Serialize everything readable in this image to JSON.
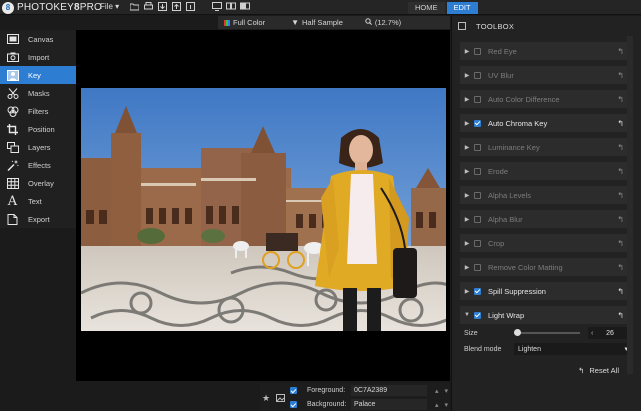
{
  "app": {
    "logo_letter": "8",
    "brand": "PHOTOKEY",
    "brand_num": "8",
    "brand_suffix": "PRO"
  },
  "menu": {
    "file": "File ▾"
  },
  "nav": {
    "home": "HOME",
    "edit": "EDIT"
  },
  "subbar": {
    "color_mode": "Full Color",
    "sample_mode": "Half Sample",
    "zoom": "(12.7%)"
  },
  "sidebar": {
    "items": [
      {
        "label": "Canvas",
        "icon": "canvas-icon"
      },
      {
        "label": "Import",
        "icon": "camera-icon"
      },
      {
        "label": "Key",
        "icon": "key-person-icon"
      },
      {
        "label": "Masks",
        "icon": "scissors-icon"
      },
      {
        "label": "Filters",
        "icon": "filters-icon"
      },
      {
        "label": "Position",
        "icon": "crop-icon"
      },
      {
        "label": "Layers",
        "icon": "layers-icon"
      },
      {
        "label": "Effects",
        "icon": "wand-icon"
      },
      {
        "label": "Overlay",
        "icon": "grid-icon"
      },
      {
        "label": "Text",
        "icon": "text-icon"
      },
      {
        "label": "Export",
        "icon": "export-icon"
      }
    ],
    "active": "Key"
  },
  "bottom": {
    "foreground_label": "Foreground:",
    "foreground_value": "0C7A2389",
    "background_label": "Background:",
    "background_value": "Palace"
  },
  "toolbox": {
    "title": "TOOLBOX",
    "tools": [
      {
        "label": "Red Eye",
        "checked": false
      },
      {
        "label": "UV Blur",
        "checked": false
      },
      {
        "label": "Auto Color Difference",
        "checked": false
      },
      {
        "label": "Auto Chroma Key",
        "checked": true
      },
      {
        "label": "Luminance Key",
        "checked": false
      },
      {
        "label": "Erode",
        "checked": false
      },
      {
        "label": "Alpha Levels",
        "checked": false
      },
      {
        "label": "Alpha Blur",
        "checked": false
      },
      {
        "label": "Crop",
        "checked": false
      },
      {
        "label": "Remove Color Matting",
        "checked": false
      },
      {
        "label": "Spill Suppression",
        "checked": true
      },
      {
        "label": "Light Wrap",
        "checked": true,
        "expanded": true
      }
    ],
    "light_wrap": {
      "size_label": "Size",
      "size_value": "26",
      "size_fraction": 0.05,
      "blend_label": "Blend mode",
      "blend_value": "Lighten"
    },
    "reset_all": "Reset All"
  },
  "colors": {
    "accent": "#2d7dd2",
    "panel": "#222222",
    "row": "#2c2c2c"
  }
}
